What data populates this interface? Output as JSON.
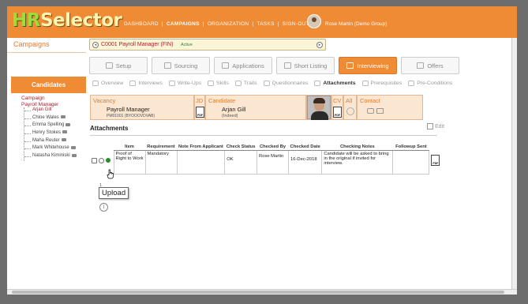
{
  "app": {
    "logo_hr": "HR",
    "logo_selector": "Selector"
  },
  "nav": {
    "items": [
      "DASHBOARD",
      "CAMPAIGNS",
      "ORGANIZATION",
      "TASKS",
      "SIGN-OUT"
    ],
    "active": "CAMPAIGNS",
    "separator": "|"
  },
  "user": {
    "name": "Rose Martin (Demo Group)"
  },
  "campaigns": {
    "label": "Campaigns",
    "selected": "C0001 Payroll Manager (FIN)",
    "status": "Active"
  },
  "stages": [
    {
      "label": "Setup",
      "icon": "setup-icon"
    },
    {
      "label": "Sourcing",
      "icon": "sourcing-icon"
    },
    {
      "label": "Applications",
      "icon": "applications-icon"
    },
    {
      "label": "Short Listing",
      "icon": "short-listing-icon"
    },
    {
      "label": "Interviewing",
      "icon": "interviewing-icon",
      "active": true
    },
    {
      "label": "Offers",
      "icon": "offers-icon"
    }
  ],
  "candidates": {
    "header": "Candidates",
    "tree": {
      "root": "Campaign",
      "campaign": "Payroll Manager",
      "people": [
        "Arjan Gill",
        "Chloe Wales",
        "Emma Spelling",
        "Henry Stokes",
        "Maha Reuter",
        "Mark Whitehouse",
        "Natasha Kiminiski"
      ],
      "selected": "Arjan Gill"
    }
  },
  "subtabs": [
    {
      "label": "Overview"
    },
    {
      "label": "Interviews"
    },
    {
      "label": "Write-Ups"
    },
    {
      "label": "Skills"
    },
    {
      "label": "Traits"
    },
    {
      "label": "Questionnaires"
    },
    {
      "label": "Attachments",
      "active": true
    },
    {
      "label": "Prerequisites"
    },
    {
      "label": "Pre-Conditions"
    }
  ],
  "info": {
    "vacancy_label": "Vacancy",
    "vacancy_title": "Payroll Manager",
    "vacancy_code": "PM01001 (BYOOOVDVAB)",
    "jd_label": "JD",
    "candidate_label": "Candidate",
    "candidate_name": "Arjan Gill",
    "candidate_source": "(Indeed)",
    "cv_label": "CV",
    "all_label": "All",
    "contact_label": "Contact",
    "pdf_text": "PDF"
  },
  "attachments": {
    "title": "Attachments",
    "edit_label": "Edit",
    "columns": [
      "Item",
      "Requirement",
      "Note From Applicant",
      "Check Status",
      "Checked By",
      "Checked Date",
      "Checking Notes",
      "Followup Sent"
    ],
    "rows": [
      {
        "item": "Proof of Right to Work",
        "requirement": "Mandatory",
        "note_from_applicant": "",
        "check_status": "OK",
        "checked_by": "Rose Martin",
        "checked_date": "16-Dec-2018",
        "checking_notes": "Candidate will be asked to bring in the original if invited for interview.",
        "followup_sent": "",
        "status_color": "#2c8a2c"
      }
    ],
    "count_text": "1",
    "tooltip": "Upload"
  },
  "colors": {
    "brand_orange": "#ef8a35",
    "link_red": "#a8202c",
    "accent_green": "#2c8a2c"
  }
}
